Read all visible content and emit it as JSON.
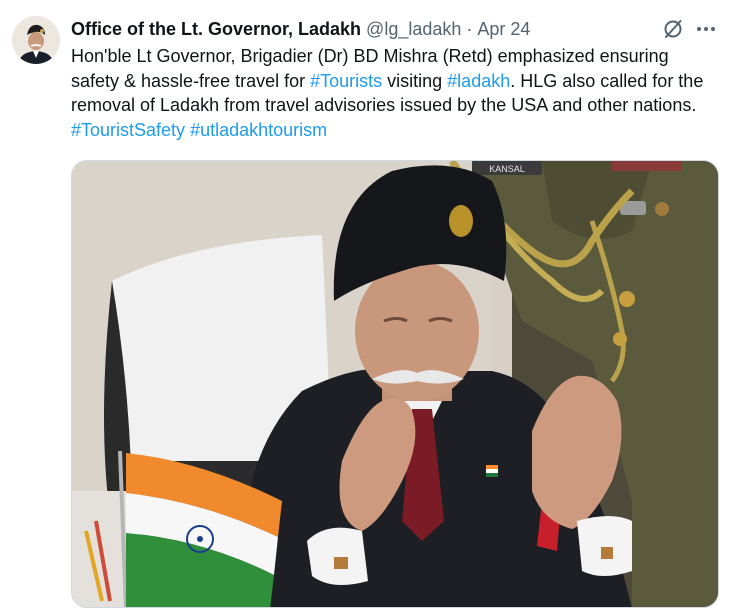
{
  "tweet": {
    "display_name": "Office of the Lt. Governor, Ladakh",
    "handle": "@lg_ladakh",
    "separator": "·",
    "date": "Apr 24",
    "text_parts": [
      "Hon'ble Lt Governor, Brigadier (Dr) BD Mishra (Retd) emphasized ensuring safety & hassle-free travel for ",
      "#Tourists",
      " visiting ",
      "#ladakh",
      ". HLG also called for the removal of Ladakh from travel advisories issued by the USA and other nations. ",
      "#TouristSafety",
      " ",
      "#utladakhtourism"
    ],
    "hashtag_color": "#1d9bf0",
    "icons": {
      "grok": "grok-icon",
      "more": "more-icon"
    },
    "media": {
      "name_badge_text": "KANSAL"
    }
  }
}
